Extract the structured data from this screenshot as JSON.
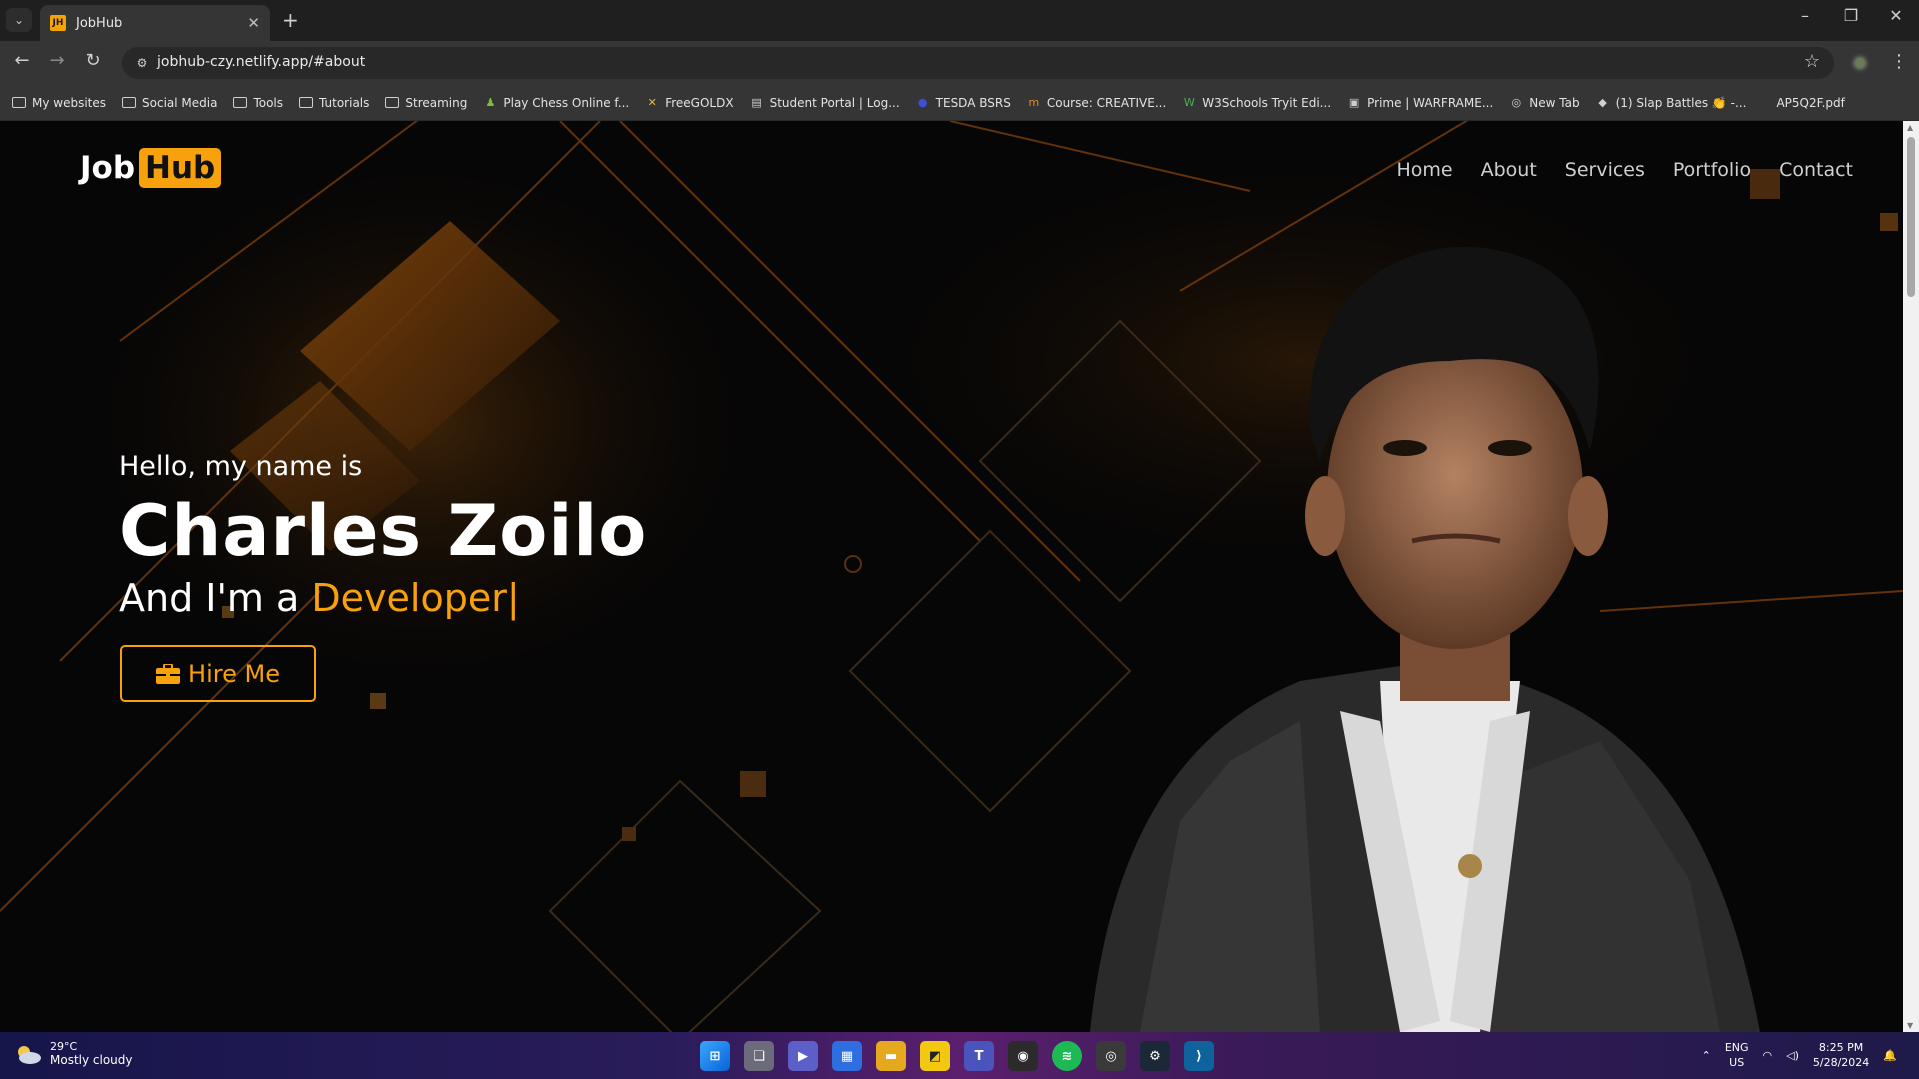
{
  "browser": {
    "tab_title": "JobHub",
    "tab_favicon": "JH",
    "url": "jobhub-czy.netlify.app/#about",
    "bookmarks": [
      {
        "label": "My websites",
        "icon": "folder-icon"
      },
      {
        "label": "Social Media",
        "icon": "folder-icon"
      },
      {
        "label": "Tools",
        "icon": "folder-icon"
      },
      {
        "label": "Tutorials",
        "icon": "folder-icon"
      },
      {
        "label": "Streaming",
        "icon": "folder-icon"
      },
      {
        "label": "Play Chess Online f...",
        "icon": "chess-icon"
      },
      {
        "label": "FreeGOLDX",
        "icon": "x-icon"
      },
      {
        "label": "Student Portal | Log...",
        "icon": "page-icon"
      },
      {
        "label": "TESDA BSRS",
        "icon": "globe-icon"
      },
      {
        "label": "Course: CREATIVE...",
        "icon": "moodle-icon"
      },
      {
        "label": "W3Schools Tryit Edi...",
        "icon": "w3-icon"
      },
      {
        "label": "Prime | WARFRAME...",
        "icon": "image-icon"
      },
      {
        "label": "New Tab",
        "icon": "chrome-icon"
      },
      {
        "label": "(1) Slap Battles 👏 -...",
        "icon": "roblox-icon"
      },
      {
        "label": "AP5Q2F.pdf",
        "icon": "pdf-icon"
      }
    ]
  },
  "site": {
    "logo_left": "Job",
    "logo_right": "Hub",
    "nav": [
      "Home",
      "About",
      "Services",
      "Portfolio",
      "Contact"
    ],
    "hero": {
      "greeting": "Hello, my name is",
      "name": "Charles Zoilo",
      "role_prefix": "And I'm a",
      "role": "Developer",
      "cursor": "|",
      "cta": "Hire Me"
    }
  },
  "taskbar": {
    "temperature": "29°C",
    "weather": "Mostly cloudy",
    "language_top": "ENG",
    "language_bottom": "US",
    "time": "8:25 PM",
    "date": "5/28/2024"
  },
  "colors": {
    "accent": "#f7a10c",
    "background": "#070707",
    "nav_text": "#cfcfcf"
  }
}
